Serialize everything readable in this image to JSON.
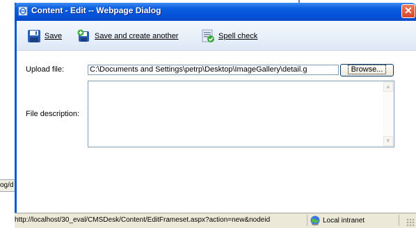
{
  "background": {
    "side_tab_text": "og/d"
  },
  "dialog": {
    "title": "Content - Edit -- Webpage Dialog",
    "close_glyph": "✕"
  },
  "toolbar": {
    "save_label": "Save",
    "save_another_label": "Save and create another",
    "spell_check_label": "Spell check"
  },
  "form": {
    "upload_label": "Upload file:",
    "upload_value": "C:\\Documents and Settings\\petrp\\Desktop\\ImageGallery\\detail.g",
    "browse_label": "Browse...",
    "description_label": "File description:",
    "description_value": ""
  },
  "statusbar": {
    "url": "http://localhost/30_eval/CMSDesk/Content/EditFrameset.aspx?action=new&nodeid",
    "zone": "Local intranet"
  },
  "icons": {
    "save": "floppy-disk-icon",
    "save_another": "floppy-disk-add-icon",
    "spell_check": "spell-check-icon",
    "zone": "globe-intranet-icon"
  },
  "colors": {
    "titlebar": "#0452d8",
    "close_button": "#d8452a",
    "toolbar_bg": "#dde8f6",
    "status_bg": "#ece9d8"
  }
}
